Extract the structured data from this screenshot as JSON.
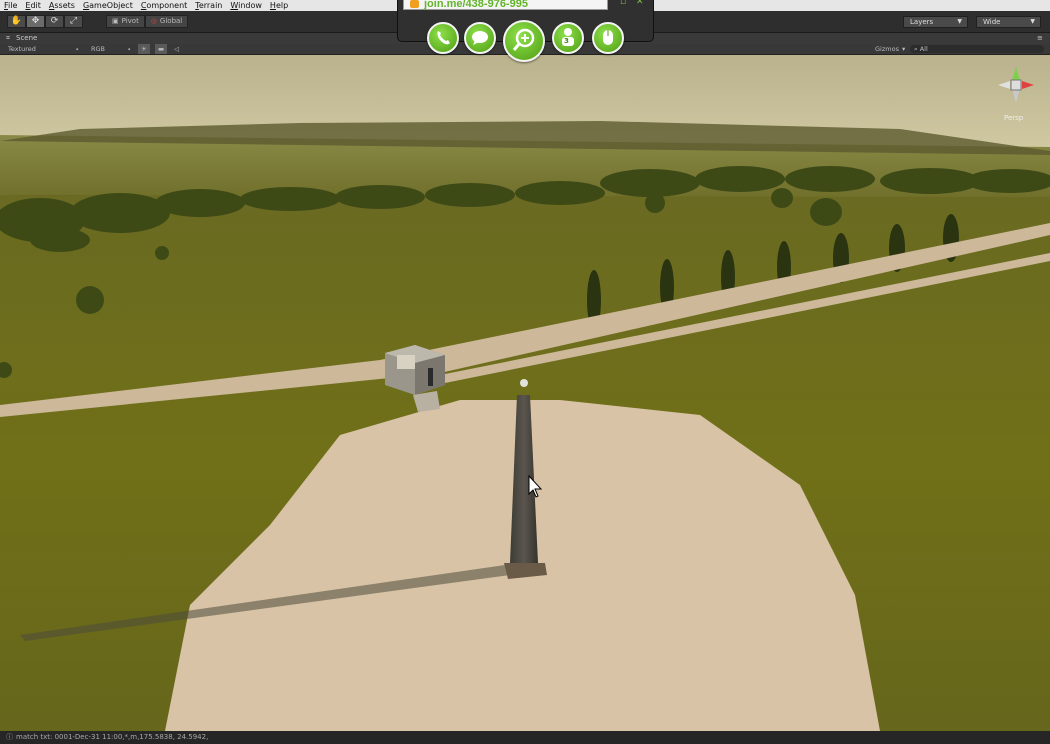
{
  "menu": [
    "File",
    "Edit",
    "Assets",
    "GameObject",
    "Component",
    "Terrain",
    "Window",
    "Help"
  ],
  "toolbar": {
    "pivot_label": "Pivot",
    "global_label": "Global",
    "layers_label": "Layers",
    "layout_label": "Wide"
  },
  "scene": {
    "tab_label": "Scene",
    "render_mode": "Textured",
    "color_mode": "RGB",
    "gizmos_label": "Gizmos",
    "search_placeholder": "All",
    "view_label": "Persp"
  },
  "joinme": {
    "url": "join.me/438-976-995",
    "participant_count": "3",
    "buttons": [
      "phone-icon",
      "chat-icon",
      "zoom-icon",
      "participants-icon",
      "mouse-icon"
    ]
  },
  "status": {
    "text": "match txt:  0001-Dec-31 11:00,*,m,175.5838, 24.5942,"
  },
  "colors": {
    "grass": "#6e6e20",
    "sky": "#cfc9a0",
    "plaza": "#d9c3a6",
    "path": "#cdb899",
    "joinme_green": "#64b42c"
  }
}
